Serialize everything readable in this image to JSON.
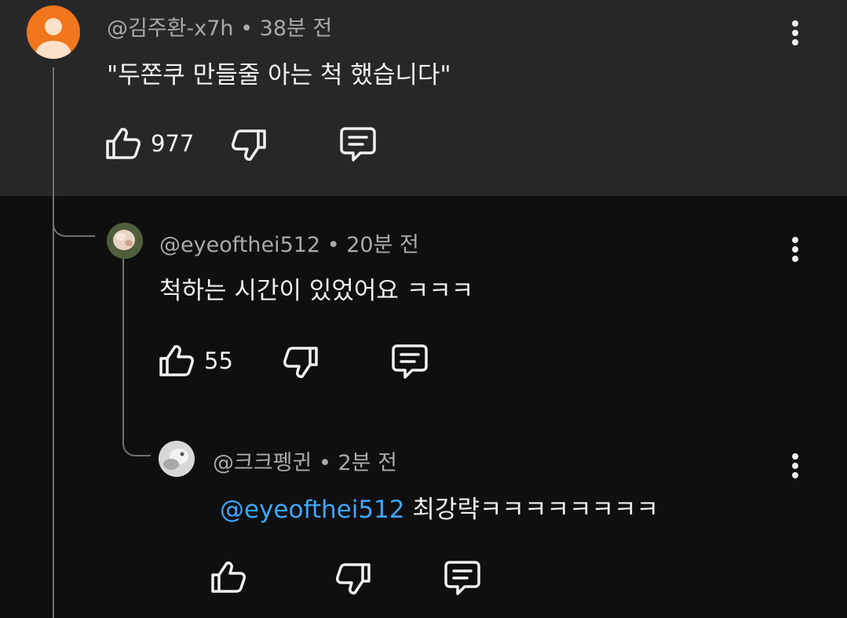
{
  "comments": [
    {
      "author": "@김주환-x7h",
      "time": "38분 전",
      "text": "\"두쫀쿠 만들줄 아는 척 했습니다\"",
      "likes": "977",
      "avatar_color": "#f1761c",
      "icons": {
        "more": "more-vert-icon",
        "like": "thumb-up-icon",
        "dislike": "thumb-down-icon",
        "reply": "reply-comment-icon"
      }
    },
    {
      "author": "@eyeofthei512",
      "time": "20분 전",
      "text": "척하는 시간이 있었어요 ㅋㅋㅋ",
      "likes": "55",
      "icons": {
        "more": "more-vert-icon",
        "like": "thumb-up-icon",
        "dislike": "thumb-down-icon",
        "reply": "reply-comment-icon"
      }
    },
    {
      "author": "@크크펭귄",
      "time": "2분 전",
      "mention": "@eyeofthei512",
      "text": " 최강략ㅋㅋㅋㅋㅋㅋㅋㅋ",
      "icons": {
        "more": "more-vert-icon",
        "like": "thumb-up-icon",
        "dislike": "thumb-down-icon",
        "reply": "reply-comment-icon"
      }
    }
  ],
  "separator": " • ",
  "colors": {
    "background": "#0f0f0f",
    "highlight": "#272727",
    "text": "#f1f1f1",
    "meta_text": "#aaaaaa",
    "mention": "#3ea6ff",
    "thread_line": "#717171"
  }
}
